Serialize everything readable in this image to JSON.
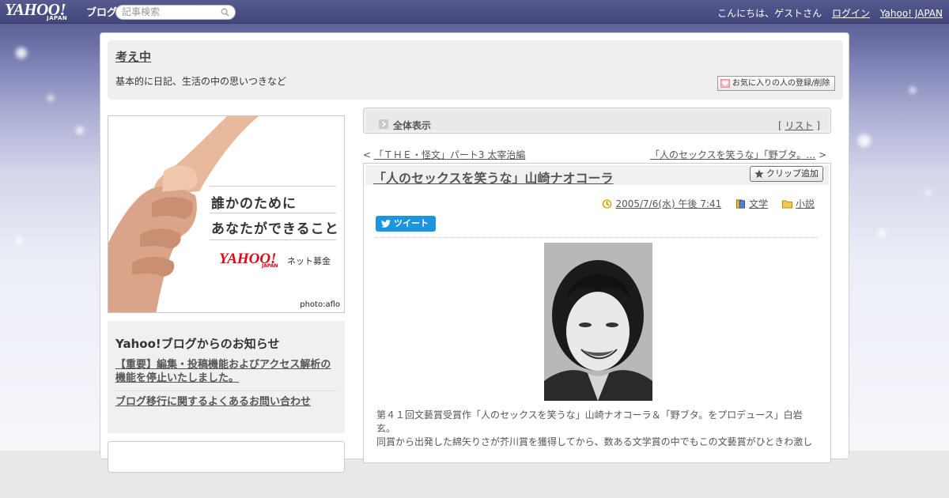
{
  "topbar": {
    "logo": "YAHOO!",
    "logo_sub": "JAPAN",
    "logo_service": "ブログ",
    "search_placeholder": "記事検索",
    "greeting": "こんにちは、ゲストさん",
    "login": "ログイン",
    "yahoo_japan": "Yahoo! JAPAN"
  },
  "blog": {
    "title": "考え中",
    "description": "基本的に日記、生活の中の思いつきなど",
    "favorite_button": "お気に入りの人の登録/削除"
  },
  "ad": {
    "line1": "誰かのために",
    "line2": "あなたができること",
    "brand": "YAHOO!",
    "brand_sub": "JAPAN",
    "service": "ネット募金",
    "credit": "photo:aflo"
  },
  "notice": {
    "title": "Yahoo!ブログからのお知らせ",
    "links": [
      "【重要】編集・投稿機能およびアクセス解析の機能を停止いたしました。",
      "ブログ移行に関するよくあるお問い合わせ"
    ]
  },
  "view_bar": {
    "label": "全体表示",
    "list_open": "[ ",
    "list_link": "リスト",
    "list_close": " ]"
  },
  "nav": {
    "prev_marker": "< ",
    "prev_title": "「ＴＨＥ・怪文」パート3 太宰治編",
    "next_title": "「人のセックスを笑うな」「野ブタ。…",
    "next_marker": " >"
  },
  "article": {
    "title": "「人のセックスを笑うな」山崎ナオコーラ",
    "clip_button": "クリップ追加",
    "datetime": "2005/7/6(水) 午後 7:41",
    "category": "文学",
    "folder": "小説",
    "tweet": "ツイート",
    "body": [
      "第４１回文藝賞受賞作「人のセックスを笑うな」山崎ナオコーラ＆「野ブタ。をプロデュース」白岩玄。",
      "同賞から出発した綿矢りさが芥川賞を獲得してから、数ある文学賞の中でもこの文藝賞がひときわ激し"
    ]
  },
  "colors": {
    "topbar": "#4a4e84",
    "tweet": "#1b95e0",
    "ad_brand": "#e60012"
  }
}
